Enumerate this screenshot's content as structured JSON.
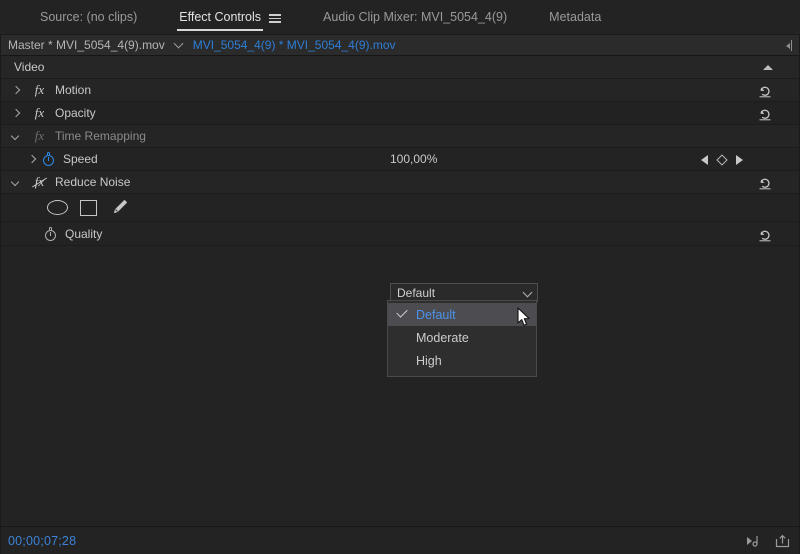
{
  "tabs": [
    {
      "label": "Source: (no clips)",
      "active": false,
      "menu": false
    },
    {
      "label": "Effect Controls",
      "active": true,
      "menu": true
    },
    {
      "label": "Audio Clip Mixer: MVI_5054_4(9)",
      "active": false,
      "menu": false
    },
    {
      "label": "Metadata",
      "active": false,
      "menu": false
    }
  ],
  "clipbar": {
    "master": "Master * MVI_5054_4(9).mov",
    "clip": "MVI_5054_4(9) * MVI_5054_4(9).mov"
  },
  "tree": {
    "section_label": "Video",
    "rows": [
      {
        "label": "Motion",
        "value": "",
        "reset": true
      },
      {
        "label": "Opacity",
        "value": "",
        "reset": true
      },
      {
        "label": "Time Remapping",
        "value": "",
        "reset": false
      },
      {
        "label": "Speed",
        "value": "100,00%",
        "reset": false
      },
      {
        "label": "Reduce Noise",
        "value": "",
        "reset": true
      },
      {
        "label": "Quality",
        "value": "",
        "reset": true
      }
    ]
  },
  "mask_tools": {
    "ellipse": "create-ellipse-mask",
    "rectangle": "create-rectangle-mask",
    "pen": "free-draw-bezier-mask"
  },
  "quality_dropdown": {
    "selected": "Default",
    "options": [
      {
        "label": "Default",
        "checked": true
      },
      {
        "label": "Moderate",
        "checked": false
      },
      {
        "label": "High",
        "checked": false
      }
    ]
  },
  "statusbar": {
    "timecode": "00;00;07;28"
  },
  "colors": {
    "accent_blue": "#2e7ed6",
    "highlight_blue": "#4b93e8",
    "panel_bg": "#232323",
    "row_alt": "#262626",
    "dropdown_bg": "#2e2e2e",
    "dropdown_selected_bg": "#4c4c51"
  }
}
